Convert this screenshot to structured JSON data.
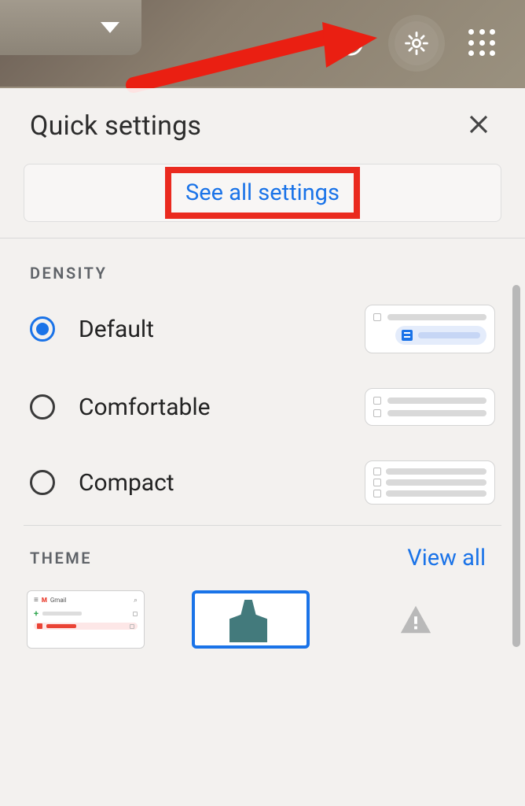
{
  "panel": {
    "title": "Quick settings",
    "see_all": "See all settings"
  },
  "density": {
    "heading": "DENSITY",
    "options": [
      {
        "label": "Default",
        "selected": true
      },
      {
        "label": "Comfortable",
        "selected": false
      },
      {
        "label": "Compact",
        "selected": false
      }
    ]
  },
  "theme": {
    "heading": "THEME",
    "view_all": "View all"
  }
}
